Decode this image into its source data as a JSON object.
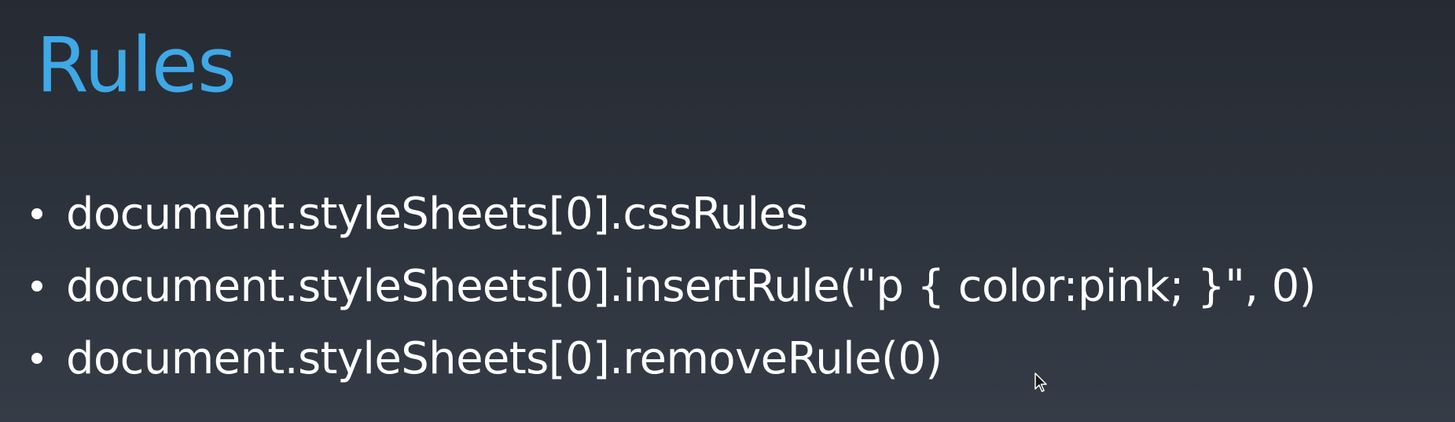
{
  "slide": {
    "title": "Rules",
    "bullets": [
      "document.styleSheets[0].cssRules",
      "document.styleSheets[0].insertRule(\"p { color:pink; }\", 0)",
      "document.styleSheets[0].removeRule(0)"
    ]
  },
  "colors": {
    "background": "#2c323b",
    "title": "#3fa8e6",
    "text": "#ffffff"
  },
  "icons": {
    "cursor": "mouse-pointer-icon"
  }
}
